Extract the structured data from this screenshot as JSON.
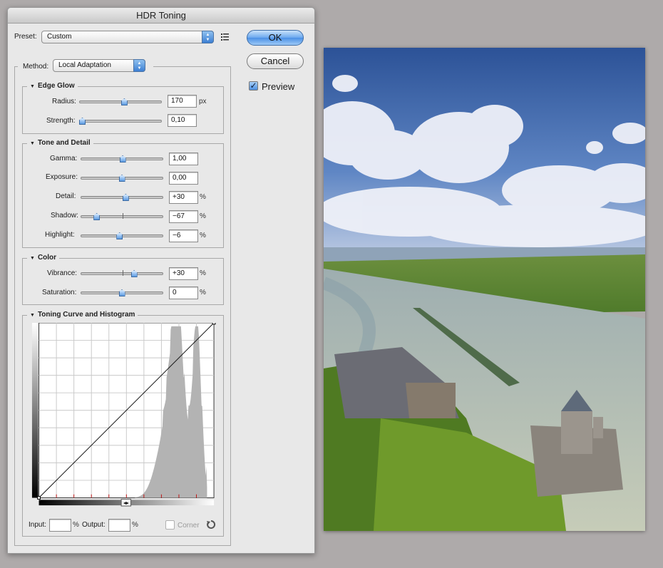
{
  "dialog": {
    "title": "HDR Toning"
  },
  "preset": {
    "label": "Preset:",
    "value": "Custom"
  },
  "method": {
    "label": "Method:",
    "value": "Local Adaptation"
  },
  "buttons": {
    "ok": "OK",
    "cancel": "Cancel"
  },
  "preview": {
    "label": "Preview",
    "checked": true
  },
  "edge_glow": {
    "title": "Edge Glow",
    "radius": {
      "label": "Radius:",
      "value": "170",
      "unit": "px",
      "slider": 0.55
    },
    "strength": {
      "label": "Strength:",
      "value": "0,10",
      "unit": "",
      "slider": 0.0
    }
  },
  "tone_detail": {
    "title": "Tone and Detail",
    "gamma": {
      "label": "Gamma:",
      "value": "1,00",
      "unit": "",
      "slider": 0.51
    },
    "exposure": {
      "label": "Exposure:",
      "value": "0,00",
      "unit": "",
      "slider": 0.5
    },
    "detail": {
      "label": "Detail:",
      "value": "+30",
      "unit": "%",
      "slider": 0.55
    },
    "shadow": {
      "label": "Shadow:",
      "value": "−67",
      "unit": "%",
      "slider": 0.17
    },
    "highlight": {
      "label": "Highlight:",
      "value": "−6",
      "unit": "%",
      "slider": 0.47
    }
  },
  "color": {
    "title": "Color",
    "vibrance": {
      "label": "Vibrance:",
      "value": "+30",
      "unit": "%",
      "slider": 0.66
    },
    "saturation": {
      "label": "Saturation:",
      "value": "0",
      "unit": "%",
      "slider": 0.5
    }
  },
  "curve": {
    "title": "Toning Curve and Histogram",
    "input_label": "Input:",
    "input_unit": "%",
    "output_label": "Output:",
    "output_unit": "%",
    "corner_label": "Corner"
  },
  "colors": {
    "accent": "#4b90e6",
    "panel": "#e8e8e8",
    "desktop": "#aeaaaa"
  },
  "icons": {
    "preset_menu": "list-icon",
    "reset": "reset-icon",
    "collapse": "triangle-down-icon"
  }
}
